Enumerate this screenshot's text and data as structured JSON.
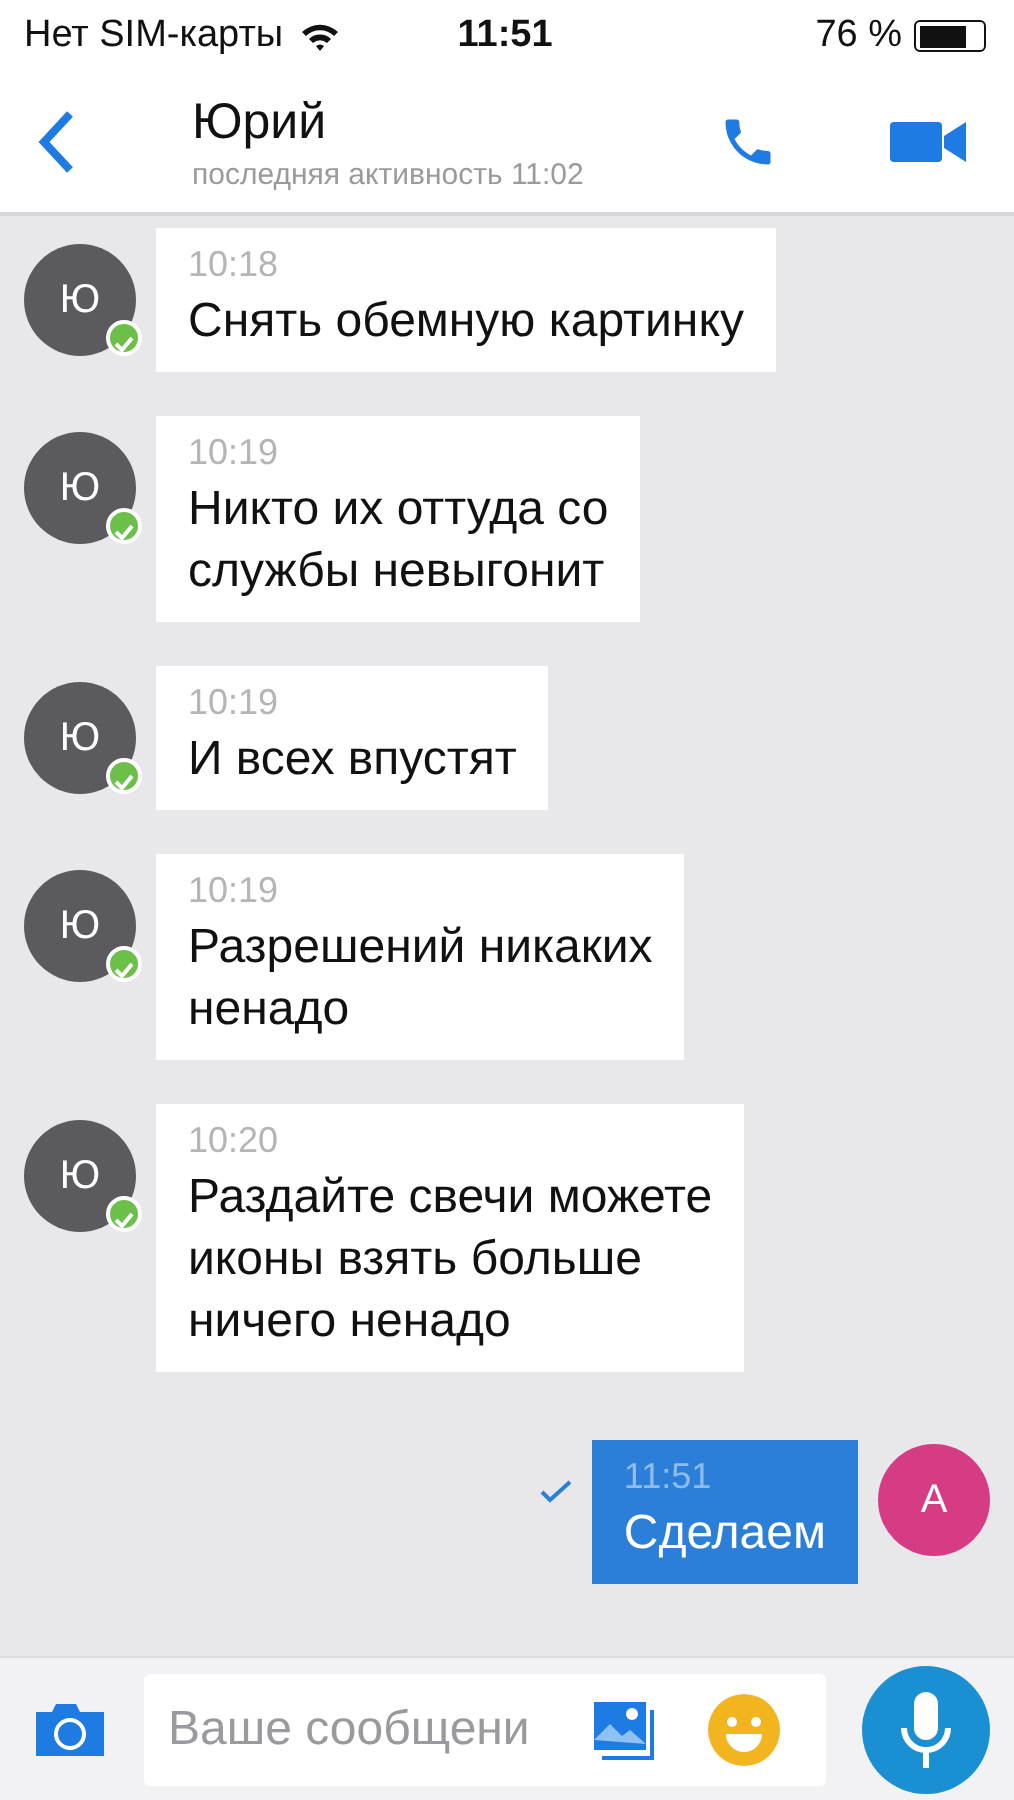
{
  "status_bar": {
    "carrier": "Нет SIM-карты",
    "time": "11:51",
    "battery": "76 %"
  },
  "header": {
    "title": "Юрий",
    "subtitle": "последняя активность 11:02"
  },
  "messages": [
    {
      "kind": "incoming",
      "avatar": "Ю",
      "online": true,
      "time": "10:18",
      "text": "Снять обемную картинку"
    },
    {
      "kind": "incoming",
      "avatar": "Ю",
      "online": true,
      "time": "10:19",
      "text": "Никто их оттуда со\nслужбы невыгонит"
    },
    {
      "kind": "incoming",
      "avatar": "Ю",
      "online": true,
      "time": "10:19",
      "text": "И всех впустят"
    },
    {
      "kind": "incoming",
      "avatar": "Ю",
      "online": true,
      "time": "10:19",
      "text": "Разрешений никаких\nненадо"
    },
    {
      "kind": "incoming",
      "avatar": "Ю",
      "online": true,
      "time": "10:20",
      "text": "Раздайте свечи можете\nиконы взять больше\nничего ненадо"
    },
    {
      "kind": "outgoing",
      "avatar": "А",
      "read": true,
      "time": "11:51",
      "text": "Сделаем"
    }
  ],
  "composer": {
    "placeholder": "Ваше сообщени"
  }
}
